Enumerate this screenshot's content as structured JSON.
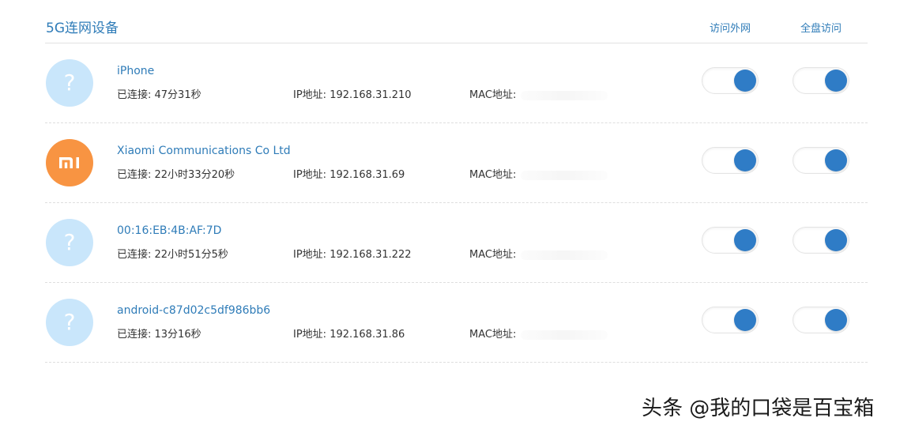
{
  "header": {
    "title": "5G连网设备",
    "col_internet": "访问外网",
    "col_disk": "全盘访问"
  },
  "labels": {
    "connected": "已连接: ",
    "ip": "IP地址: ",
    "mac": "MAC地址:"
  },
  "devices": [
    {
      "name": "iPhone",
      "icon": "question-mark-icon",
      "connected": "47分31秒",
      "ip": "192.168.31.210",
      "internet_on": true,
      "disk_on": true
    },
    {
      "name": "Xiaomi Communications Co Ltd",
      "icon": "xiaomi-logo-icon",
      "connected": "22小时33分20秒",
      "ip": "192.168.31.69",
      "internet_on": true,
      "disk_on": true
    },
    {
      "name": "00:16:EB:4B:AF:7D",
      "icon": "question-mark-icon",
      "connected": "22小时51分5秒",
      "ip": "192.168.31.222",
      "internet_on": true,
      "disk_on": true
    },
    {
      "name": "android-c87d02c5df986bb6",
      "icon": "question-mark-icon",
      "connected": "13分16秒",
      "ip": "192.168.31.86",
      "internet_on": true,
      "disk_on": true
    }
  ],
  "watermark": "头条 @我的口袋是百宝箱",
  "colors": {
    "accent": "#2f7cb8",
    "toggle_on": "#2f7cc6",
    "unknown_avatar": "#c9e6fb",
    "xiaomi_orange": "#f89442"
  }
}
